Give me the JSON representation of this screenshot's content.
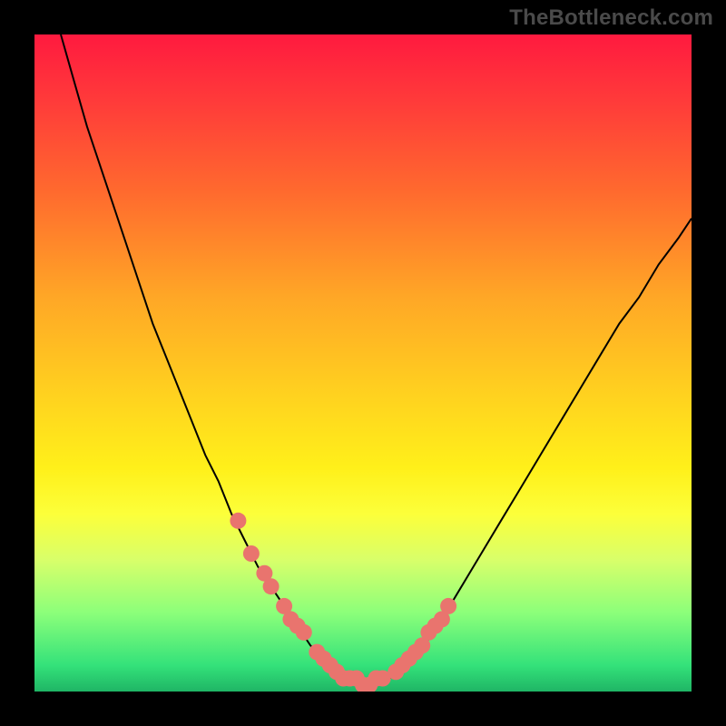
{
  "watermark": "TheBottleneck.com",
  "chart_data": {
    "type": "line",
    "title": "",
    "xlabel": "",
    "ylabel": "",
    "xlim": [
      0,
      100
    ],
    "ylim": [
      0,
      100
    ],
    "series": [
      {
        "name": "bottleneck-curve",
        "x": [
          4,
          6,
          8,
          10,
          12,
          14,
          16,
          18,
          20,
          22,
          24,
          26,
          28,
          30,
          32,
          34,
          36,
          38,
          40,
          42,
          44,
          46,
          48,
          50,
          52,
          54,
          56,
          58,
          60,
          62,
          65,
          68,
          71,
          74,
          77,
          80,
          83,
          86,
          89,
          92,
          95,
          98,
          100
        ],
        "values": [
          100,
          93,
          86,
          80,
          74,
          68,
          62,
          56,
          51,
          46,
          41,
          36,
          32,
          27,
          23,
          19,
          16,
          13,
          10,
          7,
          5,
          3,
          2,
          1,
          1,
          2,
          3,
          5,
          8,
          11,
          16,
          21,
          26,
          31,
          36,
          41,
          46,
          51,
          56,
          60,
          65,
          69,
          72
        ]
      }
    ],
    "markers": {
      "name": "highlight-points",
      "color": "#e9746e",
      "x": [
        31,
        33,
        35,
        36,
        38,
        39,
        40,
        41,
        43,
        44,
        45,
        46,
        47,
        48,
        49,
        50,
        51,
        52,
        53,
        55,
        56,
        57,
        58,
        59,
        60,
        61,
        62,
        63
      ],
      "values": [
        26,
        21,
        18,
        16,
        13,
        11,
        10,
        9,
        6,
        5,
        4,
        3,
        2,
        2,
        2,
        1,
        1,
        2,
        2,
        3,
        4,
        5,
        6,
        7,
        9,
        10,
        11,
        13
      ]
    },
    "gradient_stops": [
      {
        "pos": 0,
        "color": "#ff1a3f"
      },
      {
        "pos": 55,
        "color": "#ffd21f"
      },
      {
        "pos": 100,
        "color": "#1fb565"
      }
    ]
  }
}
